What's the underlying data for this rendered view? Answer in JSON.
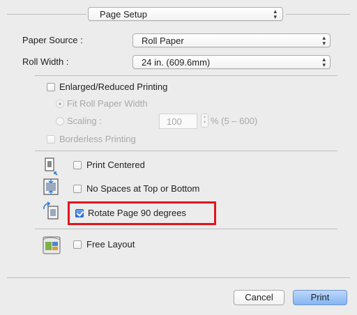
{
  "header": {
    "page_setup_popup": "Page Setup"
  },
  "paper_source": {
    "label": "Paper Source :",
    "value": "Roll Paper"
  },
  "roll_width": {
    "label": "Roll Width :",
    "value": "24 in. (609.6mm)"
  },
  "enlarged": {
    "label": "Enlarged/Reduced Printing",
    "fit_roll": "Fit Roll Paper Width",
    "scaling_label": "Scaling :",
    "scaling_value": "100",
    "scaling_range": "% (5 – 600)",
    "borderless": "Borderless Printing"
  },
  "options": {
    "print_centered": "Print Centered",
    "no_spaces": "No Spaces at Top or Bottom",
    "rotate": "Rotate Page 90 degrees",
    "free_layout": "Free Layout"
  },
  "buttons": {
    "cancel": "Cancel",
    "print": "Print"
  },
  "colors": {
    "highlight": "#e2141d",
    "accent": "#2e72d9"
  }
}
